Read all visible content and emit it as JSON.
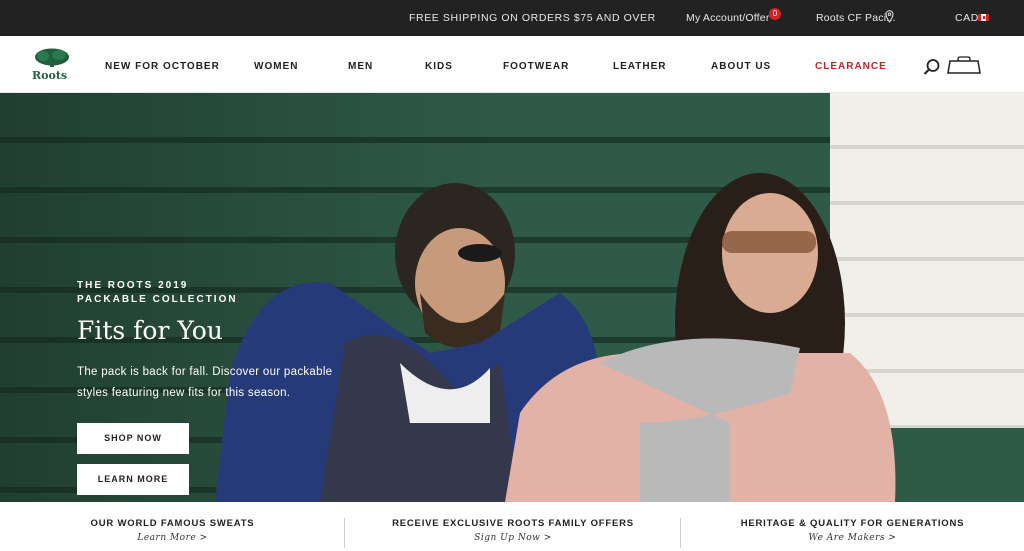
{
  "topbar": {
    "promo": "FREE SHIPPING ON ORDERS $75 AND OVER",
    "account": "My Account/Offer",
    "offers_badge": "0",
    "store": "Roots CF Paci...",
    "currency": "CAD"
  },
  "nav": {
    "logo_text": "Roots",
    "items": [
      "NEW FOR OCTOBER",
      "WOMEN",
      "MEN",
      "KIDS",
      "FOOTWEAR",
      "LEATHER",
      "ABOUT US",
      "CLEARANCE"
    ]
  },
  "hero": {
    "eyebrow_line1": "THE ROOTS 2019",
    "eyebrow_line2": "PACKABLE COLLECTION",
    "title": "Fits for You",
    "text": "The pack is back for fall. Discover our packable styles featuring new fits for this season.",
    "primary_button": "SHOP NOW",
    "secondary_button": "LEARN MORE"
  },
  "props": [
    {
      "heading": "OUR WORLD FAMOUS SWEATS",
      "link": "Learn More >"
    },
    {
      "heading": "RECEIVE EXCLUSIVE ROOTS FAMILY OFFERS",
      "link": "Sign Up Now >"
    },
    {
      "heading": "HERITAGE & QUALITY FOR GENERATIONS",
      "link": "We Are Makers >"
    }
  ],
  "colors": {
    "topbar_bg": "#222222",
    "brand_green": "#1e5f3c",
    "clearance_red": "#c0272d",
    "badge_red": "#d8202a"
  },
  "icons": [
    "map-pin-icon",
    "canada-flag-icon",
    "roots-beaver-logo",
    "search-icon",
    "shopping-bag-icon"
  ]
}
